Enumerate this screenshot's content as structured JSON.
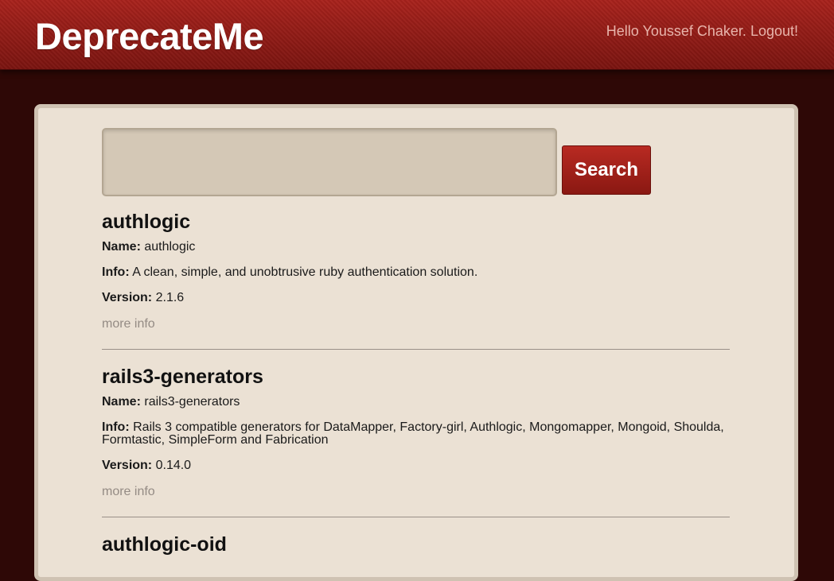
{
  "header": {
    "logo": "DeprecateMe",
    "greeting": "Hello Youssef Chaker.",
    "logout_label": "Logout!"
  },
  "search": {
    "value": "",
    "button_label": "Search"
  },
  "labels": {
    "name": "Name:",
    "info": "Info:",
    "version": "Version:",
    "more_info": "more info"
  },
  "results": [
    {
      "title": "authlogic",
      "name": "authlogic",
      "info": "A clean, simple, and unobtrusive ruby authentication solution.",
      "version": "2.1.6"
    },
    {
      "title": "rails3-generators",
      "name": "rails3-generators",
      "info": "Rails 3 compatible generators for DataMapper, Factory-girl, Authlogic, Mongomapper, Mongoid, Shoulda, Formtastic, SimpleForm and Fabrication",
      "version": "0.14.0"
    },
    {
      "title": "authlogic-oid"
    }
  ],
  "colors": {
    "header_red": "#9a1e18",
    "background": "#2e0806",
    "panel": "#ebe1d4",
    "button": "#a8231c"
  }
}
